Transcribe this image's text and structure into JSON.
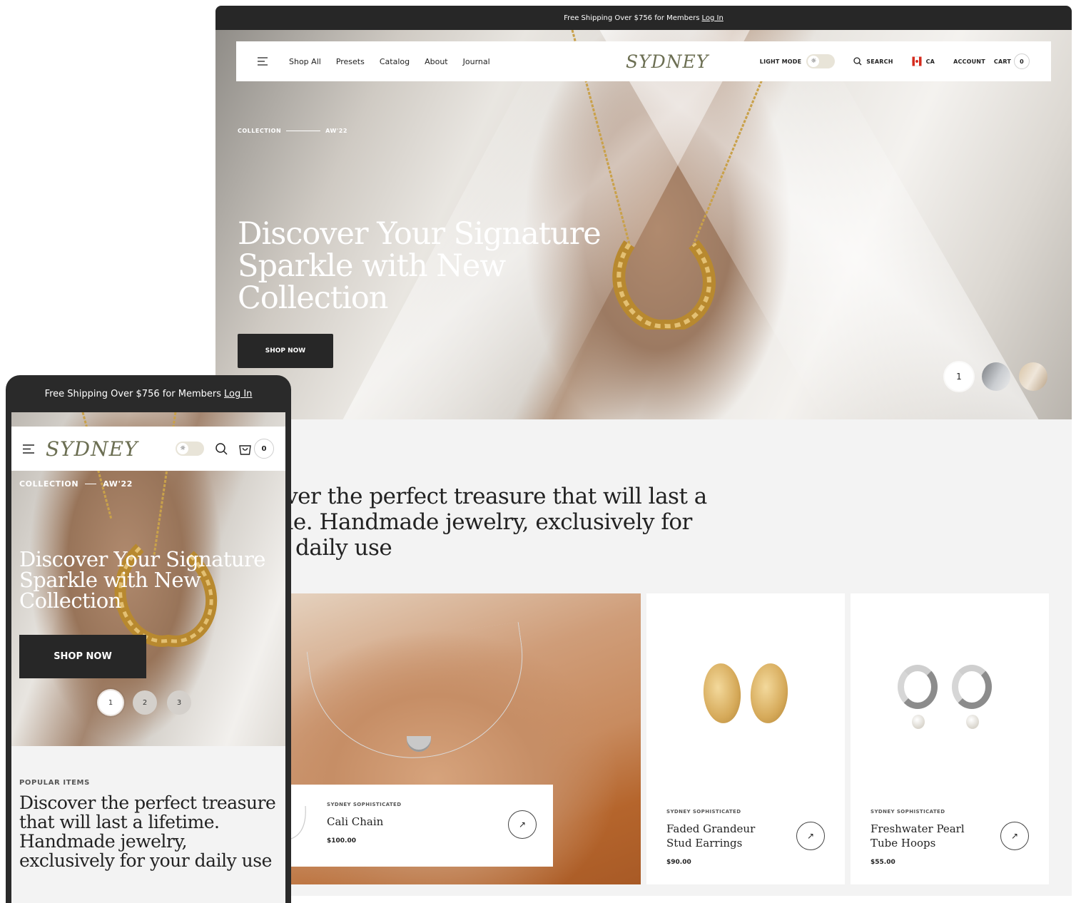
{
  "announcement": {
    "text": "Free Shipping Over $756 for Members",
    "link": "Log In"
  },
  "brand": {
    "logo": "SYDNEY",
    "logo_color": "#6c6f53"
  },
  "nav": {
    "links": [
      "Shop All",
      "Presets",
      "Catalog",
      "About",
      "Journal"
    ],
    "light_mode_label": "LIGHT MODE",
    "search_label": "SEARCH",
    "country_code": "CA",
    "account_label": "ACCOUNT",
    "cart_label": "CART",
    "cart_count": "0"
  },
  "hero": {
    "eyebrow_left": "COLLECTION",
    "eyebrow_right": "AW'22",
    "title": "Discover Your Signature Sparkle with New Collection",
    "cta": "SHOP NOW",
    "active_slide": "1",
    "mobile_slides": [
      "1",
      "2",
      "3"
    ]
  },
  "intro": {
    "desktop_visible_text": "over the perfect treasure that will last a me. Handmade jewelry, exclusively for daily use",
    "lines": [
      "over the perfect treasure that will last a",
      "me. Handmade jewelry, exclusively for",
      "daily use"
    ],
    "mobile_eyebrow": "POPULAR ITEMS",
    "mobile_text": "Discover the perfect treasure that will last a lifetime. Handmade jewelry, exclusively for your daily use"
  },
  "products": [
    {
      "brand": "SYDNEY SOPHISTICATED",
      "name": "Cali Chain",
      "price": "$100.00"
    },
    {
      "brand": "SYDNEY SOPHISTICATED",
      "name": "Faded Grandeur Stud Earrings",
      "price": "$90.00"
    },
    {
      "brand": "SYDNEY SOPHISTICATED",
      "name": "Freshwater Pearl Tube Hoops",
      "price": "$55.00"
    }
  ],
  "colors": {
    "dark": "#272727",
    "accent": "#6c6f53",
    "bg": "#f3f3f3"
  },
  "icons": {
    "menu": "menu-icon",
    "search": "search-icon",
    "cart": "cart-icon",
    "sun": "sun-icon",
    "flag": "canada-flag-icon",
    "arrow": "arrow-up-right-icon"
  }
}
